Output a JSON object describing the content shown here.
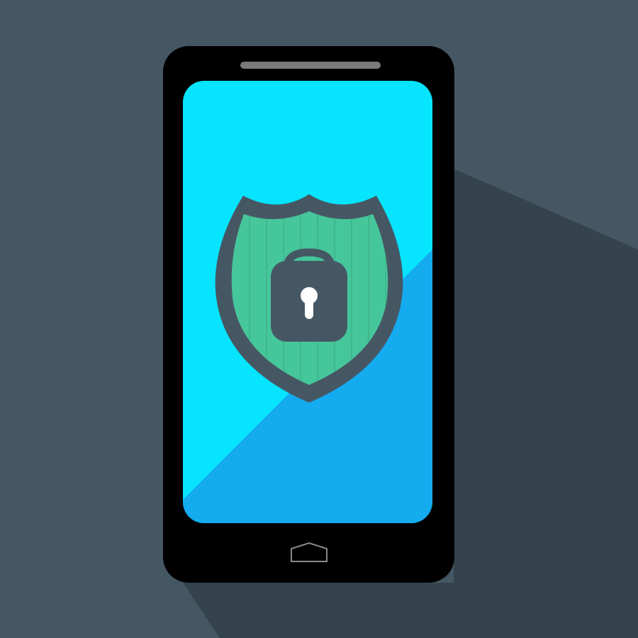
{
  "illustration": {
    "subject": "smartphone-security",
    "icons": [
      "phone-icon",
      "shield-icon",
      "padlock-icon",
      "keyhole-icon",
      "home-button-icon"
    ]
  },
  "colors": {
    "background": "#465764",
    "long_shadow": "#35434d",
    "phone_body": "#000000",
    "speaker": "#7a7a7a",
    "screen_light": "#07e4fd",
    "screen_dark": "#14abef",
    "shield_frame": "#465764",
    "shield_fill": "#46c69b",
    "shield_plank_line": "#3fb88e",
    "padlock": "#465764",
    "keyhole": "#ffffff",
    "home_button_outline": "#8a8a8a"
  }
}
